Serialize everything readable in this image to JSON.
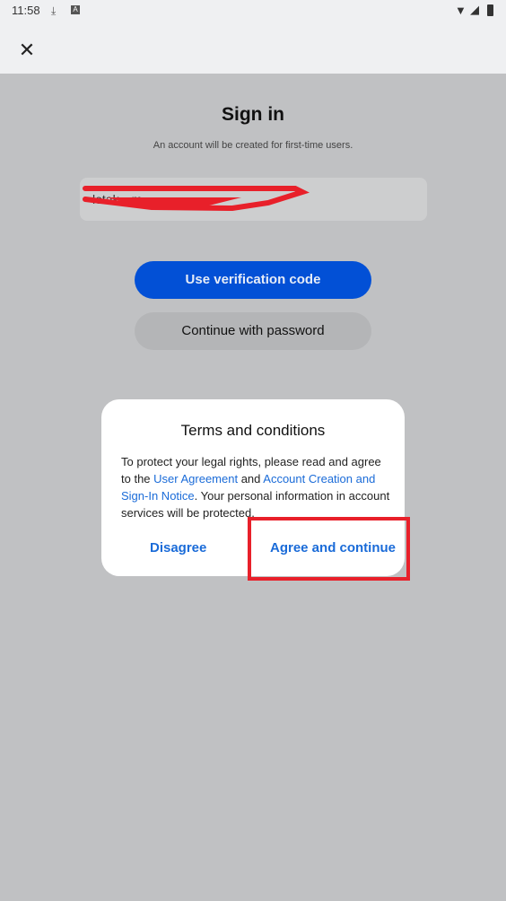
{
  "status_bar": {
    "time": "11:58",
    "icons": [
      "download-icon",
      "app-notification-icon",
      "wifi-icon",
      "signal-icon",
      "battery-icon"
    ]
  },
  "header": {
    "close_icon": "close-icon"
  },
  "signin": {
    "title": "Sign in",
    "subtitle": "An account will be created for first-time users.",
    "account_field_value": "lotak…m",
    "verification_button": "Use verification code",
    "password_button": "Continue with password"
  },
  "dialog": {
    "title": "Terms and conditions",
    "text_1": "To protect your legal rights, please read and agree to the ",
    "link_1": "User Agreement",
    "text_2": " and ",
    "link_2": "Account Creation and Sign-In Notice",
    "text_3": ". Your personal information in account services will be protected.",
    "disagree": "Disagree",
    "agree": "Agree and continue"
  },
  "colors": {
    "primary": "#0250d6",
    "link": "#1a6bd8",
    "highlight": "#e8202a"
  }
}
